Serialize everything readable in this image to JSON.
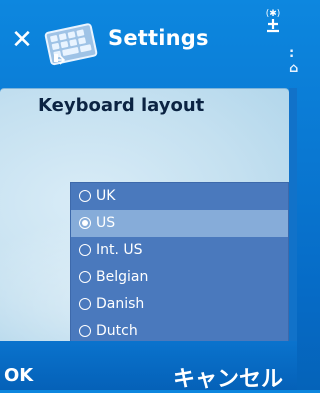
{
  "header": {
    "title": "Settings",
    "close_icon": "close-icon",
    "app_icon": "keyboard-icon",
    "status_icon": "bluetooth-signal-icon"
  },
  "dialog": {
    "prompt": "Keyboard layout",
    "options": [
      {
        "label": "UK",
        "selected": false
      },
      {
        "label": "US",
        "selected": true
      },
      {
        "label": "Int. US",
        "selected": false
      },
      {
        "label": "Belgian",
        "selected": false
      },
      {
        "label": "Danish",
        "selected": false
      },
      {
        "label": "Dutch",
        "selected": false
      }
    ]
  },
  "softkeys": {
    "left": "OK",
    "right": "キャンセル"
  },
  "colors": {
    "background": "#0a78d2",
    "list_bg": "#4a79bd",
    "selected_bg": "#86acd9",
    "text_dark": "#0b2342"
  }
}
